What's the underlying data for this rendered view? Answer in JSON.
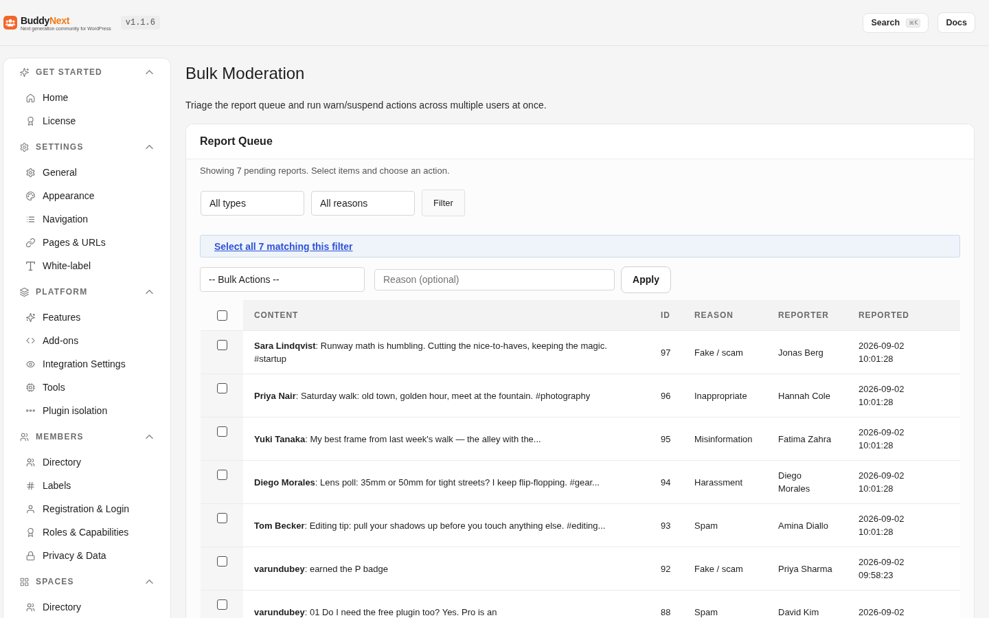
{
  "header": {
    "brand": {
      "name": "Buddy",
      "name_accent": "Next",
      "tagline": "Next generation community for WordPress"
    },
    "version": "v1.1.6",
    "search": {
      "label": "Search",
      "shortcut": "⌘K"
    },
    "docs_button": "Docs"
  },
  "sidebar": {
    "sections": [
      {
        "title": "GET STARTED",
        "kind": "sparkles",
        "expanded": true,
        "items": [
          {
            "label": "Home",
            "kind": "home",
            "selected": false
          },
          {
            "label": "License",
            "kind": "award",
            "selected": false
          }
        ]
      },
      {
        "title": "SETTINGS",
        "kind": "gear",
        "expanded": true,
        "items": [
          {
            "label": "General",
            "kind": "gear",
            "selected": false
          },
          {
            "label": "Appearance",
            "kind": "palette",
            "selected": false
          },
          {
            "label": "Navigation",
            "kind": "list",
            "selected": false
          },
          {
            "label": "Pages & URLs",
            "kind": "link",
            "selected": false
          },
          {
            "label": "White-label",
            "kind": "type",
            "selected": false
          }
        ]
      },
      {
        "title": "PLATFORM",
        "kind": "layers",
        "expanded": true,
        "items": [
          {
            "label": "Features",
            "kind": "sparkles",
            "selected": false
          },
          {
            "label": "Add-ons",
            "kind": "code",
            "selected": false
          },
          {
            "label": "Integration Settings",
            "kind": "eye",
            "selected": false
          },
          {
            "label": "Tools",
            "kind": "chip",
            "selected": false
          },
          {
            "label": "Plugin isolation",
            "kind": "dots",
            "selected": false
          }
        ]
      },
      {
        "title": "MEMBERS",
        "kind": "users",
        "expanded": true,
        "items": [
          {
            "label": "Directory",
            "kind": "users",
            "selected": false
          },
          {
            "label": "Labels",
            "kind": "hash",
            "selected": false
          },
          {
            "label": "Registration & Login",
            "kind": "user",
            "selected": false
          },
          {
            "label": "Roles & Capabilities",
            "kind": "award",
            "selected": false
          },
          {
            "label": "Privacy & Data",
            "kind": "lock",
            "selected": false
          }
        ]
      },
      {
        "title": "SPACES",
        "kind": "grid",
        "expanded": true,
        "items": [
          {
            "label": "Directory",
            "kind": "users",
            "selected": false
          }
        ]
      }
    ]
  },
  "page": {
    "title": "Bulk Moderation",
    "description": "Triage the report queue and run warn/suspend actions across multiple users at once."
  },
  "report_queue": {
    "title": "Report Queue",
    "summary": "Showing 7 pending reports. Select items and choose an action.",
    "filters": {
      "type_select": "All types",
      "reason_select": "All reasons",
      "filter_button": "Filter"
    },
    "select_all_link": "Select all 7 matching this filter",
    "bulk_actions": {
      "action_select": "-- Bulk Actions --",
      "reason_placeholder": "Reason (optional)",
      "apply_button": "Apply"
    },
    "table": {
      "select_all_checked": false,
      "columns": [
        "CONTENT",
        "ID",
        "REASON",
        "REPORTER",
        "REPORTED"
      ],
      "rows": [
        {
          "checked": false,
          "content": "**Sara Lindqvist**: Runway math is humbling. Cutting the nice-to-haves, keeping the magic. #startup",
          "id": "97",
          "reason": "Fake / scam",
          "reporter": "Jonas Berg",
          "reported": "2026-09-02 10:01:28"
        },
        {
          "checked": false,
          "content": "**Priya Nair**: Saturday walk: old town, golden hour, meet at the fountain. #photography",
          "id": "96",
          "reason": "Inappropriate",
          "reporter": "Hannah Cole",
          "reported": "2026-09-02 10:01:28"
        },
        {
          "checked": false,
          "content": "**Yuki Tanaka**: My best frame from last week's walk — the alley with the...",
          "id": "95",
          "reason": "Misinformation",
          "reporter": "Fatima Zahra",
          "reported": "2026-09-02 10:01:28"
        },
        {
          "checked": false,
          "content": "**Diego Morales**: Lens poll: 35mm or 50mm for tight streets? I keep flip-flopping. #gear...",
          "id": "94",
          "reason": "Harassment",
          "reporter": "Diego Morales",
          "reported": "2026-09-02 10:01:28"
        },
        {
          "checked": false,
          "content": "**Tom Becker**: Editing tip: pull your shadows up before you touch anything else. #editing...",
          "id": "93",
          "reason": "Spam",
          "reporter": "Amina Diallo",
          "reported": "2026-09-02 10:01:28"
        },
        {
          "checked": false,
          "content": "**varundubey**: earned the P badge",
          "id": "92",
          "reason": "Fake / scam",
          "reporter": "Priya Sharma",
          "reported": "2026-09-02 09:58:23"
        },
        {
          "checked": false,
          "content": "**varundubey**: 01 Do I need the free plugin too? Yes. Pro is an",
          "id": "88",
          "reason": "Spam",
          "reporter": "David Kim",
          "reported": "2026-09-02"
        }
      ]
    }
  }
}
